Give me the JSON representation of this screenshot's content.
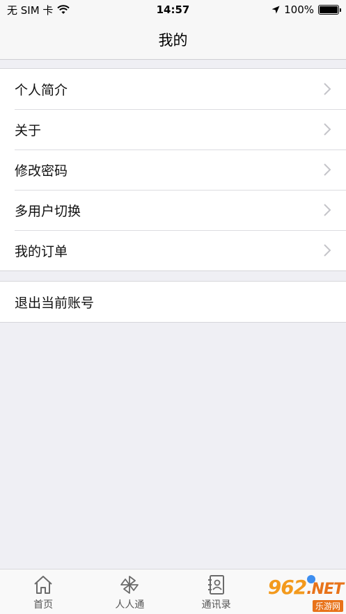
{
  "status_bar": {
    "carrier": "无 SIM 卡",
    "time": "14:57",
    "battery": "100%",
    "icons": [
      "wifi-icon",
      "location-arrow-icon",
      "battery-icon"
    ]
  },
  "nav": {
    "title": "我的"
  },
  "menu": {
    "items": [
      {
        "label": "个人简介"
      },
      {
        "label": "关于"
      },
      {
        "label": "修改密码"
      },
      {
        "label": "多用户切换"
      },
      {
        "label": "我的订单"
      }
    ],
    "logout_label": "退出当前账号"
  },
  "tabbar": {
    "tabs": [
      {
        "label": "首页",
        "icon": "home-icon"
      },
      {
        "label": "人人通",
        "icon": "pinwheel-icon"
      },
      {
        "label": "通讯录",
        "icon": "contacts-book-icon"
      },
      {
        "label": "",
        "icon": "profile-icon"
      }
    ]
  },
  "watermark": {
    "main": "962",
    "suffix": ".NET",
    "sub": "乐游网"
  },
  "colors": {
    "badge": "#3d8ef0",
    "watermark": "#f39a1d"
  }
}
